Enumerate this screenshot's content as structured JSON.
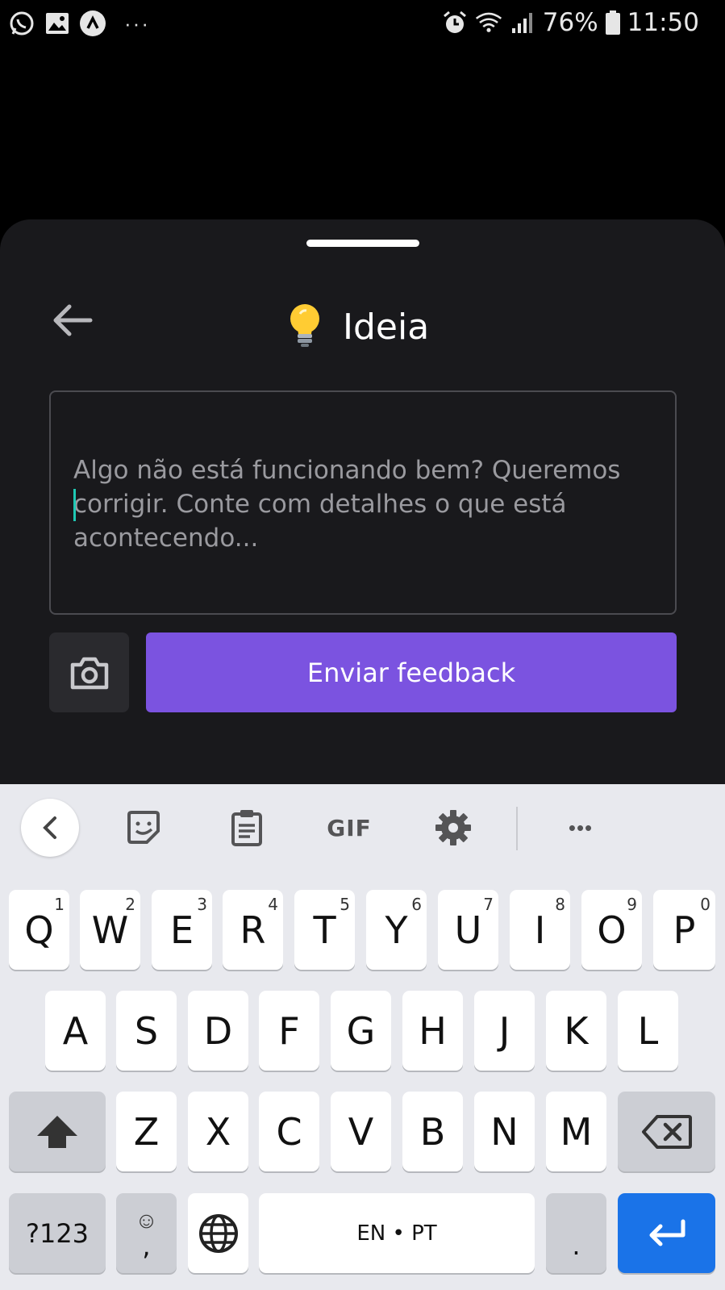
{
  "status_bar": {
    "battery_percent": "76%",
    "time": "11:50",
    "overflow_dots": "···"
  },
  "sheet": {
    "title": "Ideia",
    "title_emoji": "💡",
    "placeholder": "Algo não está funcionando bem? Queremos corrigir. Conte com detalhes o que está acontecendo...",
    "send_label": "Enviar feedback",
    "accent_color": "#7b53e0"
  },
  "keyboard": {
    "toolbar": {
      "gif_label": "GIF",
      "more_label": "•••"
    },
    "row1": [
      {
        "k": "Q",
        "n": "1"
      },
      {
        "k": "W",
        "n": "2"
      },
      {
        "k": "E",
        "n": "3"
      },
      {
        "k": "R",
        "n": "4"
      },
      {
        "k": "T",
        "n": "5"
      },
      {
        "k": "Y",
        "n": "6"
      },
      {
        "k": "U",
        "n": "7"
      },
      {
        "k": "I",
        "n": "8"
      },
      {
        "k": "O",
        "n": "9"
      },
      {
        "k": "P",
        "n": "0"
      }
    ],
    "row2": [
      "A",
      "S",
      "D",
      "F",
      "G",
      "H",
      "J",
      "K",
      "L"
    ],
    "row3": [
      "Z",
      "X",
      "C",
      "V",
      "B",
      "N",
      "M"
    ],
    "symbols_label": "?123",
    "emoji_key_top": "☺",
    "emoji_key_bottom": ",",
    "space_label": "EN • PT",
    "period_label": ".",
    "enter_color": "#1a73e8"
  }
}
